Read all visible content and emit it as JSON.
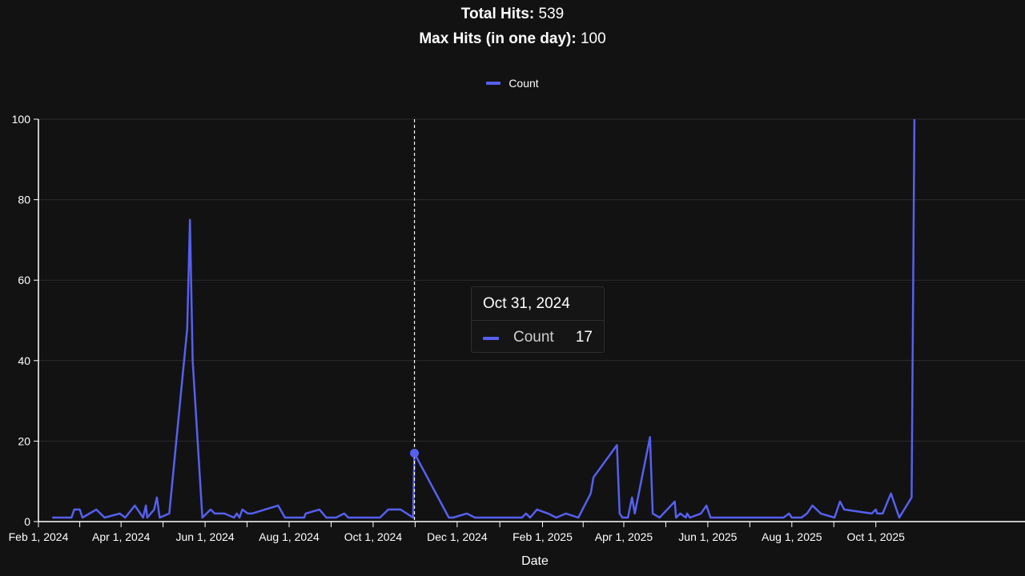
{
  "header": {
    "total_label": "Total Hits:",
    "total_value": "539",
    "max_label": "Max Hits (in one day):",
    "max_value": "100"
  },
  "colors": {
    "background": "#121212",
    "series": "#5660f0",
    "grid": "#2c2c2c",
    "text": "#ffffff"
  },
  "tooltip": {
    "date": "Oct 31, 2024",
    "series_name": "Count",
    "value": "17"
  },
  "chart_data": {
    "type": "line",
    "title": "",
    "xlabel": "Date",
    "ylabel": "",
    "ylim": [
      0,
      100
    ],
    "xlim": [
      "2024-02-01",
      "2025-10-27"
    ],
    "y_ticks": [
      "0",
      "20",
      "40",
      "60",
      "80",
      "100"
    ],
    "x_ticks": [
      {
        "date": "2024-02-01",
        "label": "Feb 1, 2024"
      },
      {
        "date": "2024-04-01",
        "label": "Apr 1, 2024"
      },
      {
        "date": "2024-06-01",
        "label": "Jun 1, 2024"
      },
      {
        "date": "2024-08-01",
        "label": "Aug 1, 2024"
      },
      {
        "date": "2024-10-01",
        "label": "Oct 1, 2024"
      },
      {
        "date": "2024-12-01",
        "label": "Dec 1, 2024"
      },
      {
        "date": "2025-02-01",
        "label": "Feb 1, 2025"
      },
      {
        "date": "2025-04-01",
        "label": "Apr 1, 2025"
      },
      {
        "date": "2025-06-01",
        "label": "Jun 1, 2025"
      },
      {
        "date": "2025-08-01",
        "label": "Aug 1, 2025"
      },
      {
        "date": "2025-10-01",
        "label": "Oct 1, 2025"
      }
    ],
    "grid": true,
    "legend_position": "top-center",
    "series": [
      {
        "name": "Count",
        "color": "#5660f0",
        "points": [
          [
            "2024-02-11",
            1
          ],
          [
            "2024-02-25",
            1
          ],
          [
            "2024-02-27",
            3
          ],
          [
            "2024-03-02",
            3
          ],
          [
            "2024-03-04",
            1
          ],
          [
            "2024-03-14",
            3
          ],
          [
            "2024-03-20",
            1
          ],
          [
            "2024-03-31",
            2
          ],
          [
            "2024-04-04",
            1
          ],
          [
            "2024-04-11",
            4
          ],
          [
            "2024-04-17",
            1
          ],
          [
            "2024-04-19",
            4
          ],
          [
            "2024-04-20",
            1
          ],
          [
            "2024-04-25",
            3
          ],
          [
            "2024-04-27",
            6
          ],
          [
            "2024-04-29",
            1
          ],
          [
            "2024-05-06",
            2
          ],
          [
            "2024-05-19",
            48
          ],
          [
            "2024-05-21",
            75
          ],
          [
            "2024-05-23",
            40
          ],
          [
            "2024-05-30",
            1
          ],
          [
            "2024-06-05",
            3
          ],
          [
            "2024-06-08",
            2
          ],
          [
            "2024-06-15",
            2
          ],
          [
            "2024-06-22",
            1
          ],
          [
            "2024-06-24",
            2
          ],
          [
            "2024-06-26",
            1
          ],
          [
            "2024-06-28",
            3
          ],
          [
            "2024-07-02",
            2
          ],
          [
            "2024-07-05",
            2
          ],
          [
            "2024-07-24",
            4
          ],
          [
            "2024-07-29",
            1
          ],
          [
            "2024-08-12",
            1
          ],
          [
            "2024-08-13",
            2
          ],
          [
            "2024-08-23",
            3
          ],
          [
            "2024-08-28",
            1
          ],
          [
            "2024-09-04",
            1
          ],
          [
            "2024-09-10",
            2
          ],
          [
            "2024-09-13",
            1
          ],
          [
            "2024-10-06",
            1
          ],
          [
            "2024-10-12",
            3
          ],
          [
            "2024-10-21",
            3
          ],
          [
            "2024-10-30",
            1
          ],
          [
            "2024-10-31",
            17
          ],
          [
            "2024-11-25",
            1
          ],
          [
            "2024-11-28",
            1
          ],
          [
            "2024-12-08",
            2
          ],
          [
            "2024-12-14",
            1
          ],
          [
            "2025-01-17",
            1
          ],
          [
            "2025-01-20",
            2
          ],
          [
            "2025-01-23",
            1
          ],
          [
            "2025-01-28",
            3
          ],
          [
            "2025-02-05",
            2
          ],
          [
            "2025-02-11",
            1
          ],
          [
            "2025-02-18",
            2
          ],
          [
            "2025-02-27",
            1
          ],
          [
            "2025-03-08",
            7
          ],
          [
            "2025-03-10",
            11
          ],
          [
            "2025-03-27",
            19
          ],
          [
            "2025-03-29",
            2
          ],
          [
            "2025-03-31",
            1
          ],
          [
            "2025-04-04",
            1
          ],
          [
            "2025-04-07",
            6
          ],
          [
            "2025-04-09",
            2
          ],
          [
            "2025-04-20",
            21
          ],
          [
            "2025-04-22",
            2
          ],
          [
            "2025-04-27",
            1
          ],
          [
            "2025-05-08",
            5
          ],
          [
            "2025-05-09",
            1
          ],
          [
            "2025-05-12",
            2
          ],
          [
            "2025-05-16",
            1
          ],
          [
            "2025-05-17",
            2
          ],
          [
            "2025-05-19",
            1
          ],
          [
            "2025-05-27",
            2
          ],
          [
            "2025-05-31",
            4
          ],
          [
            "2025-06-03",
            1
          ],
          [
            "2025-07-26",
            1
          ],
          [
            "2025-07-30",
            2
          ],
          [
            "2025-08-01",
            1
          ],
          [
            "2025-08-08",
            1
          ],
          [
            "2025-08-12",
            2
          ],
          [
            "2025-08-16",
            4
          ],
          [
            "2025-08-22",
            2
          ],
          [
            "2025-09-01",
            1
          ],
          [
            "2025-09-05",
            5
          ],
          [
            "2025-09-08",
            3
          ],
          [
            "2025-09-28",
            2
          ],
          [
            "2025-10-01",
            3
          ],
          [
            "2025-10-02",
            2
          ],
          [
            "2025-10-06",
            2
          ],
          [
            "2025-10-12",
            7
          ],
          [
            "2025-10-18",
            1
          ],
          [
            "2025-10-27",
            6
          ],
          [
            "2025-10-29",
            100
          ]
        ]
      }
    ],
    "hover": {
      "date": "2024-10-31",
      "value": 17
    }
  }
}
